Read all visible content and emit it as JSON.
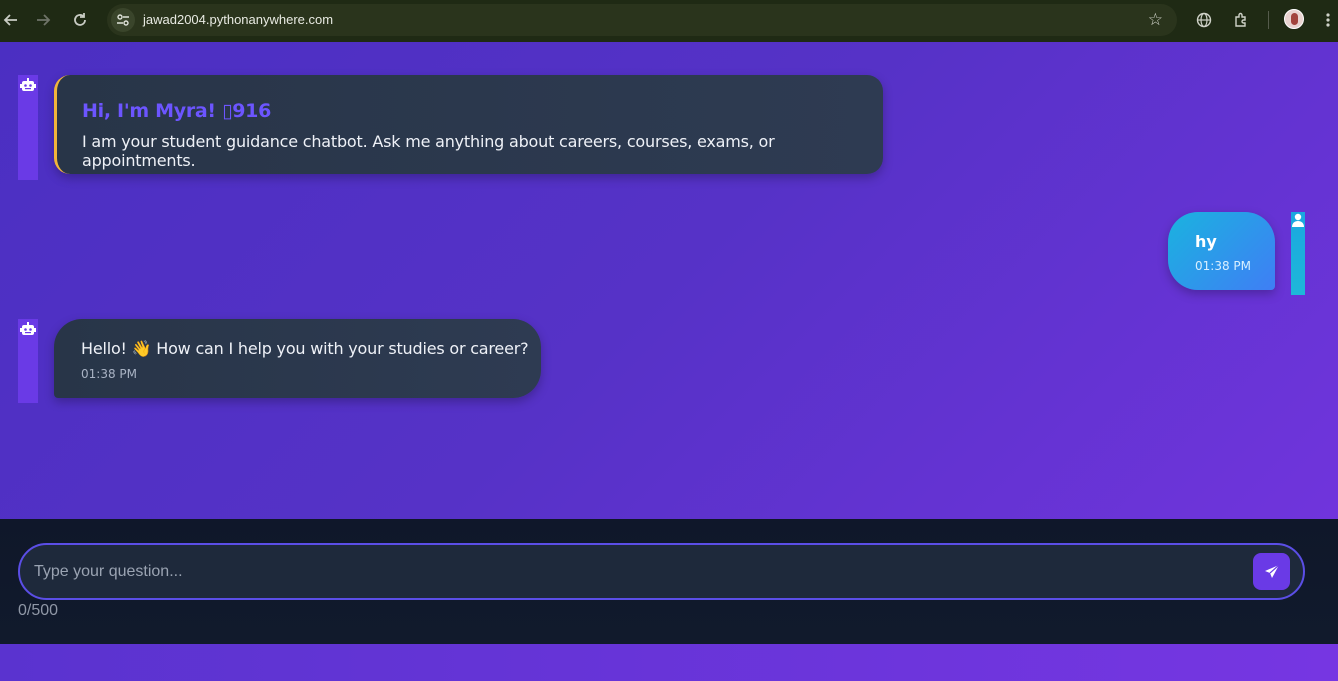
{
  "browser": {
    "url": "jawad2004.pythonanywhere.com",
    "icons": [
      "back-icon",
      "forward-icon",
      "reload-icon",
      "site-info-icon",
      "bookmark-star-icon",
      "translate-icon",
      "extensions-icon",
      "profile-avatar",
      "menu-icon"
    ]
  },
  "chat": {
    "welcome": {
      "title": "Hi, I'm Myra! ▯916",
      "text": "I am your student guidance chatbot. Ask me anything about careers, courses, exams, or appointments."
    },
    "messages": [
      {
        "sender": "user",
        "text": "hy",
        "time": "01:38 PM"
      },
      {
        "sender": "bot",
        "text": "Hello! 👋 How can I help you with your studies or career?",
        "time": "01:38 PM"
      }
    ]
  },
  "composer": {
    "placeholder": "Type your question...",
    "value": "",
    "counter": "0/500",
    "send_icon": "paper-plane-icon"
  },
  "colors": {
    "background_gradient_start": "#4b2fc2",
    "background_gradient_end": "#7034dc",
    "bot_bubble": "#2b384d",
    "welcome_accent": "#f2b53a",
    "welcome_title": "#6c55ff",
    "user_bubble_start": "#1ab3df",
    "user_bubble_end": "#3f7ef5",
    "send_button": "#6a3ae6",
    "input_border": "#5b4ee6"
  }
}
